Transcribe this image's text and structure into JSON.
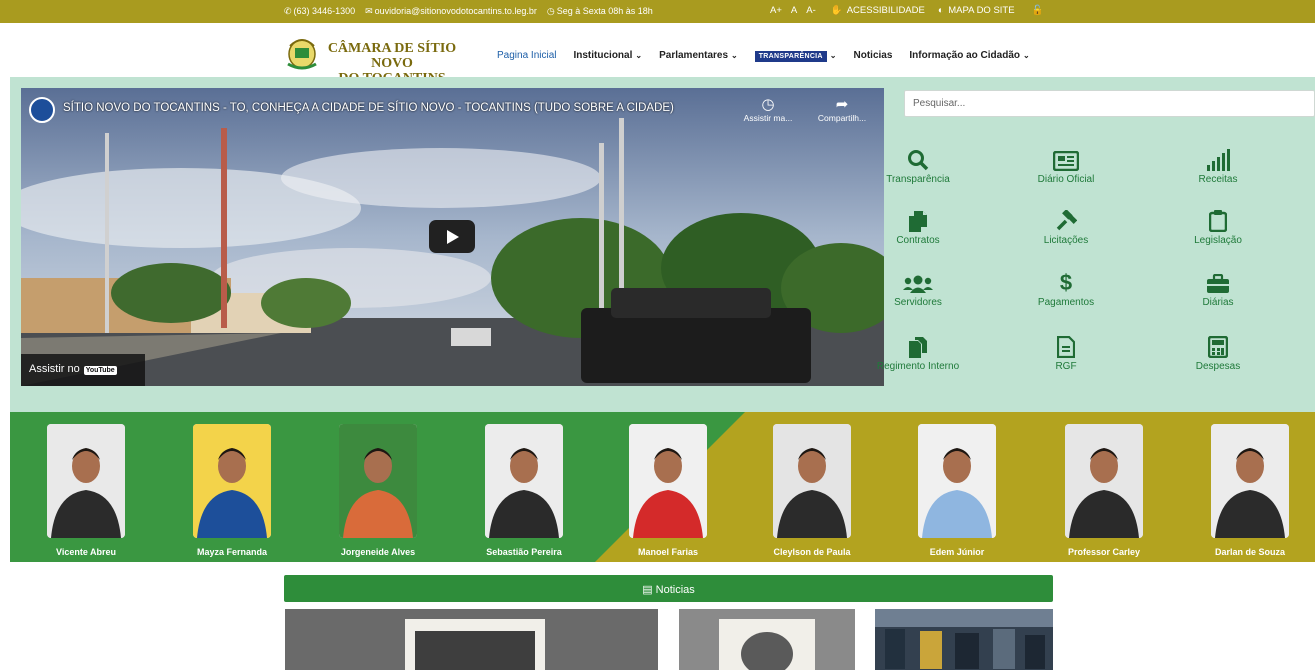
{
  "topbar": {
    "phone": "(63) 3446-1300",
    "email": "ouvidoria@sitionovodotocantins.to.leg.br",
    "hours": "Seg à Sexta 08h às 18h",
    "font_plus": "A+",
    "font_reset": "A",
    "font_minus": "A-",
    "accessibility": "ACESSIBILIDADE",
    "sitemap": "MAPA DO SITE"
  },
  "logo": {
    "line1": "CÂMARA DE SÍTIO NOVO",
    "line2": "DO TOCANTINS"
  },
  "nav": {
    "home": "Pagina Inicial",
    "institutional": "Institucional",
    "parliamentarians": "Parlamentares",
    "transparency": "TRANSPARÊNCIA",
    "news": "Noticias",
    "citizen_info": "Informação ao Cidadão"
  },
  "video": {
    "title": "SÍTIO NOVO DO TOCANTINS - TO, CONHEÇA A CIDADE DE SÍTIO NOVO - TOCANTINS (TUDO SOBRE A CIDADE)",
    "watch_later": "Assistir ma...",
    "share": "Compartilh...",
    "watch_on": "Assistir no",
    "youtube": "YouTube"
  },
  "search": {
    "placeholder": "Pesquisar..."
  },
  "quick_links": [
    {
      "label": "Transparência",
      "icon": "search-icon"
    },
    {
      "label": "Diário Oficial",
      "icon": "newspaper-icon"
    },
    {
      "label": "Receitas",
      "icon": "signal-bars-icon"
    },
    {
      "label": "Contratos",
      "icon": "copy-icon"
    },
    {
      "label": "Licitações",
      "icon": "gavel-icon"
    },
    {
      "label": "Legislação",
      "icon": "clipboard-icon"
    },
    {
      "label": "Servidores",
      "icon": "users-icon"
    },
    {
      "label": "Pagamentos",
      "icon": "dollar-icon"
    },
    {
      "label": "Diárias",
      "icon": "briefcase-icon"
    },
    {
      "label": "Regimento Interno",
      "icon": "files-icon"
    },
    {
      "label": "RGF",
      "icon": "file-icon"
    },
    {
      "label": "Despesas",
      "icon": "calculator-icon"
    }
  ],
  "councillors": [
    {
      "name": "Vicente Abreu"
    },
    {
      "name": "Mayza Fernanda"
    },
    {
      "name": "Jorgeneide Alves"
    },
    {
      "name": "Sebastião Pereira"
    },
    {
      "name": "Manoel Farias"
    },
    {
      "name": "Cleylson de Paula"
    },
    {
      "name": "Edem Júnior"
    },
    {
      "name": "Professor Carley"
    },
    {
      "name": "Darlan de Souza"
    }
  ],
  "news": {
    "title": "Noticias"
  },
  "colors": {
    "olive": "#a99b1f",
    "green": "#2e8d3a",
    "mint": "#c0e3d2",
    "link_green": "#1f7a3a",
    "navy": "#1f3a8a"
  }
}
